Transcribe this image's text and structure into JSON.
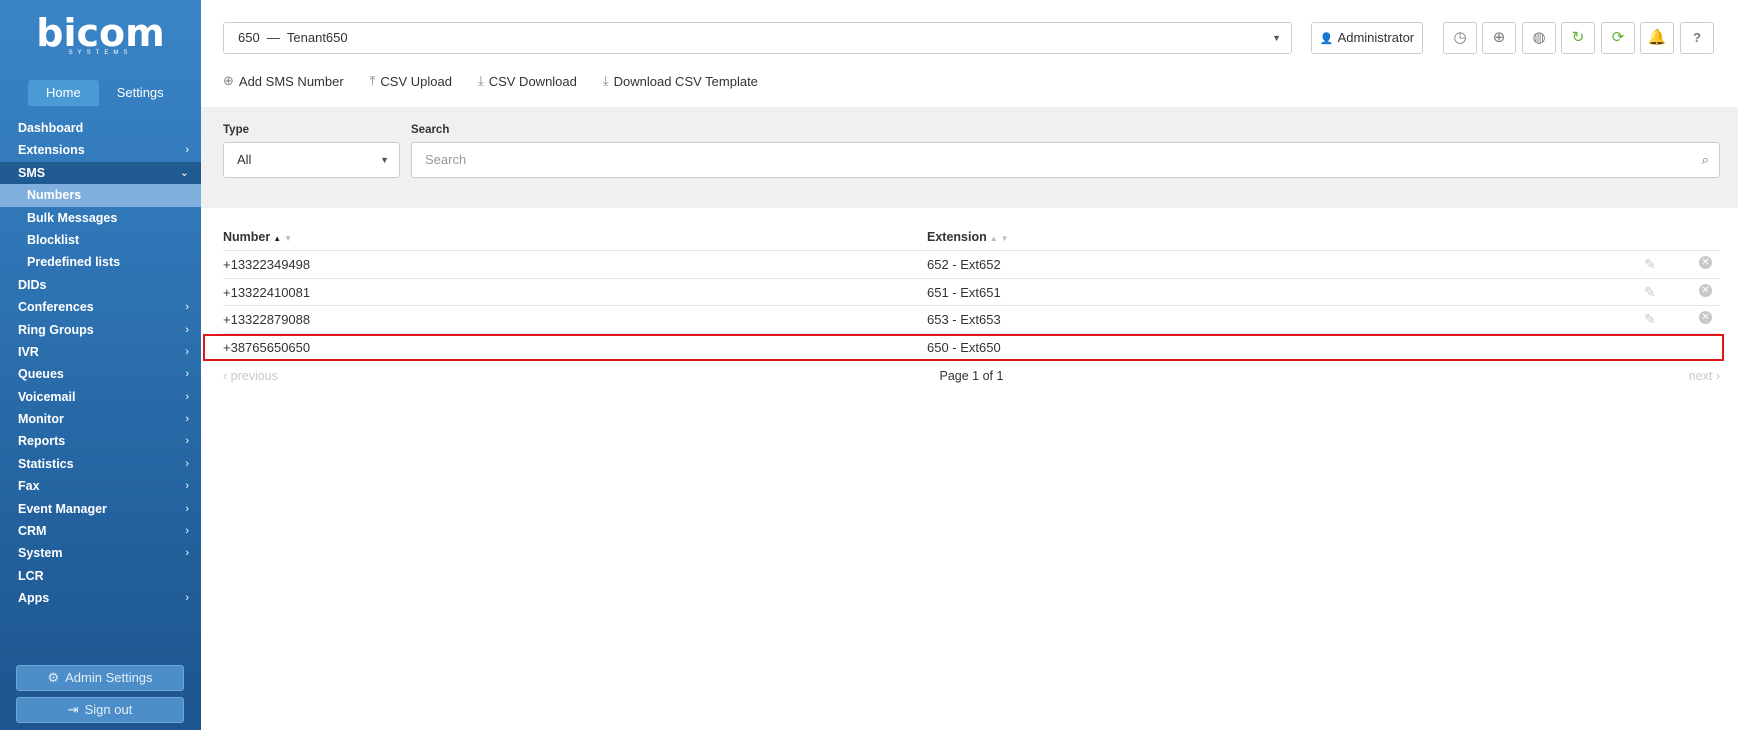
{
  "brand": {
    "name": "bicom",
    "subtitle": "SYSTEMS"
  },
  "tabs": [
    {
      "label": "Home",
      "active": true
    },
    {
      "label": "Settings",
      "active": false
    }
  ],
  "nav": {
    "dashboard": "Dashboard",
    "extensions": "Extensions",
    "sms": "SMS",
    "sms_sub": [
      "Numbers",
      "Bulk Messages",
      "Blocklist",
      "Predefined lists"
    ],
    "dids": "DIDs",
    "conferences": "Conferences",
    "ring_groups": "Ring Groups",
    "ivr": "IVR",
    "queues": "Queues",
    "voicemail": "Voicemail",
    "monitor": "Monitor",
    "reports": "Reports",
    "statistics": "Statistics",
    "fax": "Fax",
    "event_manager": "Event Manager",
    "crm": "CRM",
    "system": "System",
    "lcr": "LCR",
    "apps": "Apps"
  },
  "sidebar_buttons": {
    "admin_settings": "Admin Settings",
    "sign_out": "Sign out"
  },
  "topbar": {
    "tenant": "650  —  Tenant650",
    "user": "Administrator",
    "icons": [
      "clock-icon",
      "support-icon",
      "globe-icon",
      "reload-icon",
      "sync-icon",
      "bell-icon",
      "help-icon"
    ]
  },
  "actions": {
    "add": "Add SMS Number",
    "csv_upload": "CSV Upload",
    "csv_download": "CSV Download",
    "csv_template": "Download CSV Template"
  },
  "filters": {
    "type_label": "Type",
    "type_value": "All",
    "search_label": "Search",
    "search_placeholder": "Search"
  },
  "table": {
    "col_number": "Number",
    "col_extension": "Extension",
    "rows": [
      {
        "number": "+13322349498",
        "extension": "652 - Ext652"
      },
      {
        "number": "+13322410081",
        "extension": "651 - Ext651"
      },
      {
        "number": "+13322879088",
        "extension": "653 - Ext653"
      },
      {
        "number": "+38765650650",
        "extension": "650 - Ext650"
      }
    ]
  },
  "pager": {
    "prev": "‹ previous",
    "info": "Page 1 of 1",
    "next": "next ›"
  },
  "colors": {
    "highlight": "#e0181b",
    "sidebar": "#2f75b5",
    "green": "#5cb531"
  }
}
